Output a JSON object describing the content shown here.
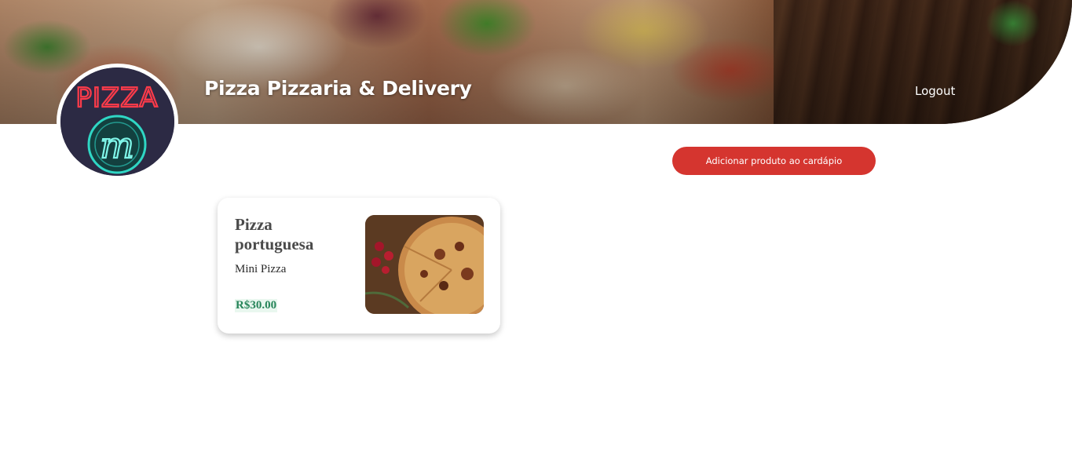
{
  "header": {
    "title": "Pizza Pizzaria & Delivery",
    "logout_label": "Logout"
  },
  "logo": {
    "text": "PIZZA",
    "monogram": "m",
    "colors": {
      "neon_red": "#ff3b4a",
      "neon_teal": "#2fd6c4"
    }
  },
  "actions": {
    "add_product_label": "Adicionar produto ao cardápio"
  },
  "products": [
    {
      "name": "Pizza portuguesa",
      "description": "Mini Pizza",
      "price": "R$30.00"
    }
  ],
  "colors": {
    "accent_button": "#d5352f",
    "price_text": "#27855a",
    "price_background": "#e9f7ef"
  }
}
